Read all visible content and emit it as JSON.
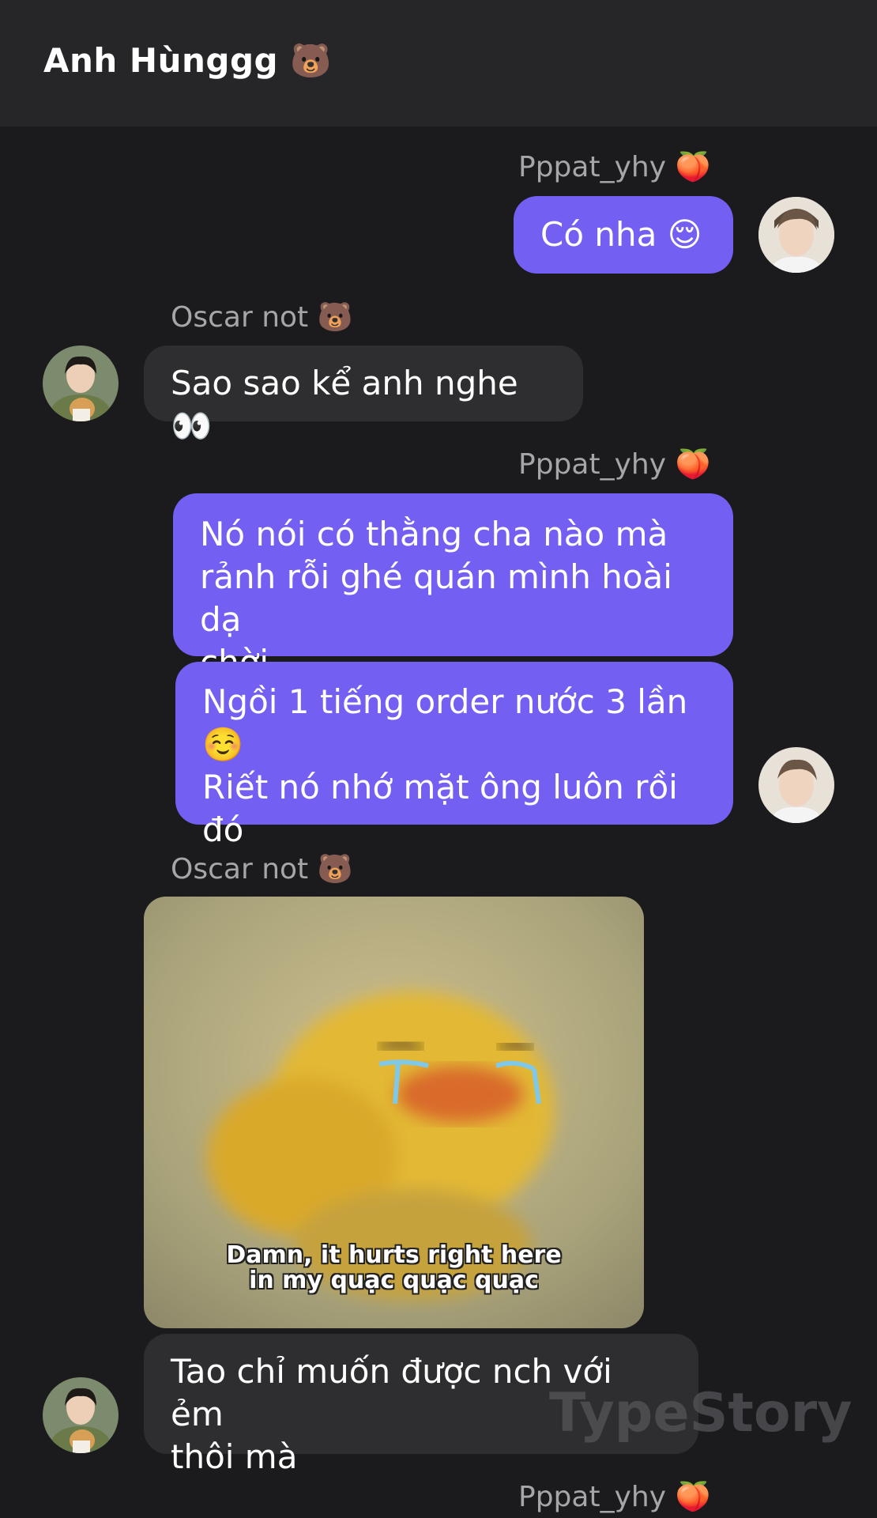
{
  "chat": {
    "title": "Anh Hùnggg 🐻"
  },
  "users": {
    "me_name": "Pppat_yhy 🍑",
    "other_name": "Oscar not 🐻"
  },
  "messages": {
    "m1": "Có nha 😌",
    "m2": "Sao sao kể anh nghe👀",
    "m3": "Nó nói có thằng cha nào mà\nrảnh rỗi ghé quán mình hoài dạ\nchời",
    "m4": "Ngồi 1 tiếng order nước 3 lần\n☺️\nRiết nó nhớ mặt ông luôn rồi đó",
    "photo_caption_line1": "Damn, it hurts right here",
    "photo_caption_line2": "in my quạc quạc quạc",
    "m5": "Tao chỉ muốn được nch với ẻm\nthôi mà"
  },
  "watermark": "TypeStory",
  "colors": {
    "background": "#1b1b1d",
    "header": "#262628",
    "outgoing_bubble": "#7360f2",
    "incoming_bubble": "#2e2e30"
  }
}
